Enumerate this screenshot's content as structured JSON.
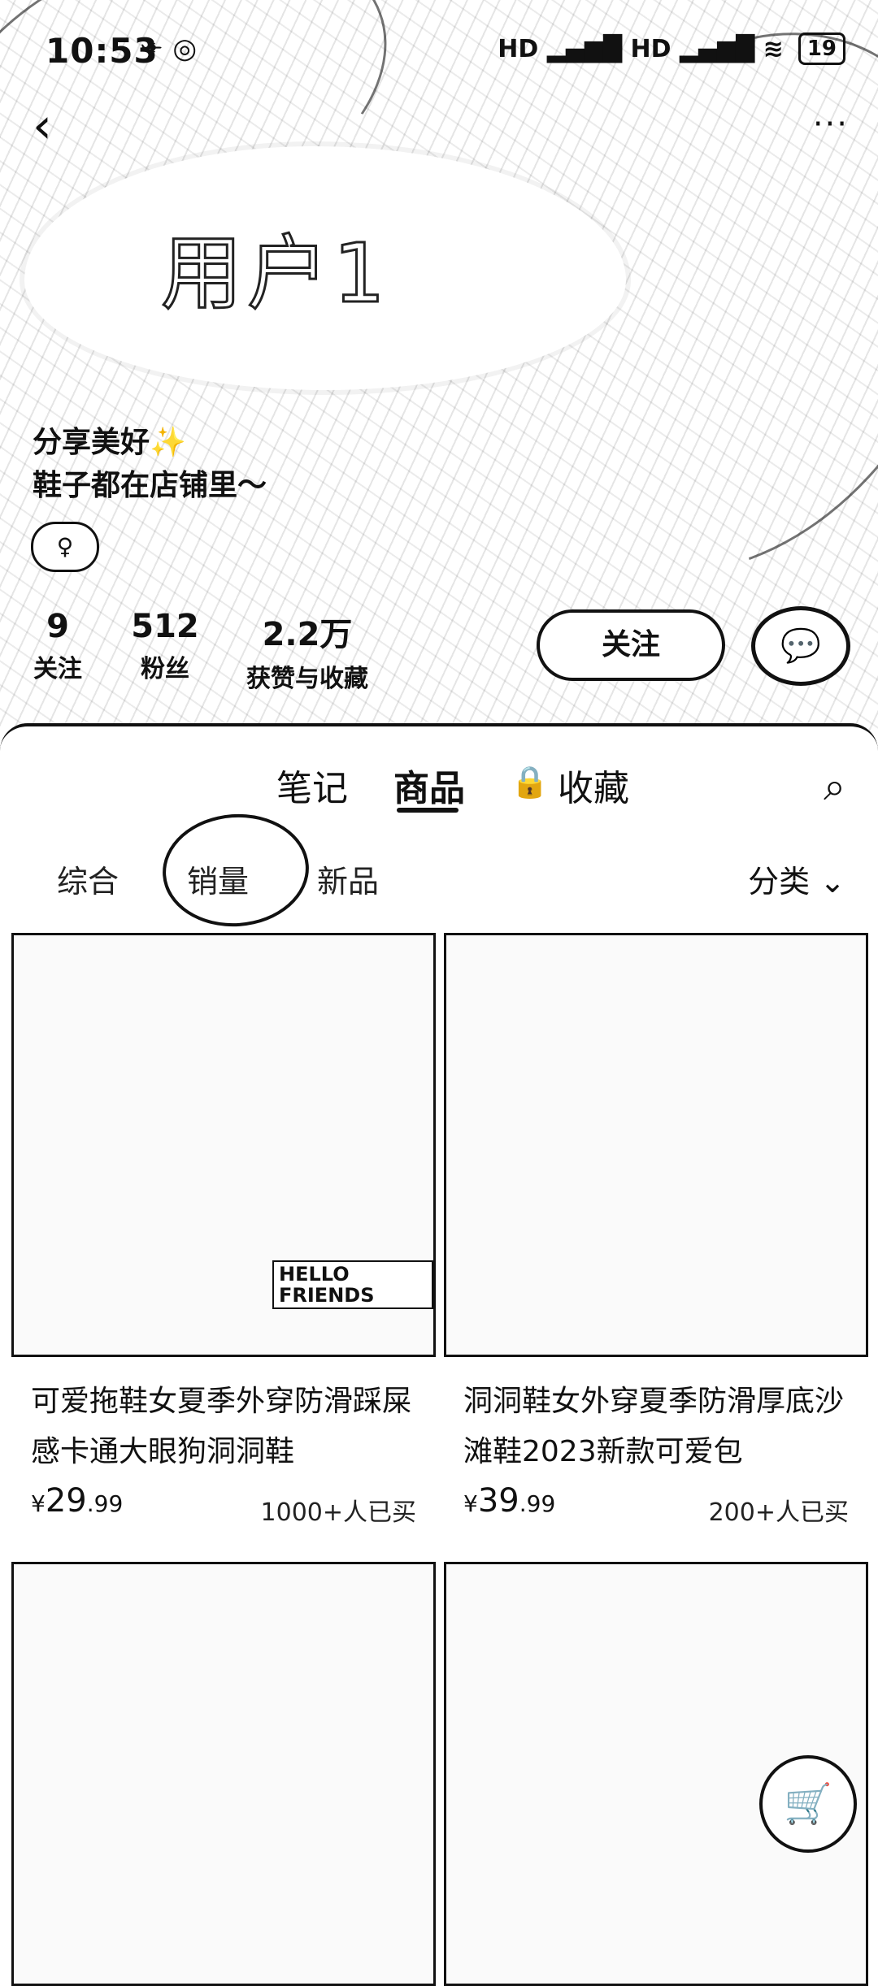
{
  "status_bar": {
    "time": "10:53",
    "icons_left": "✈ ◎",
    "network": "HD ▂▄▆█ HD ▂▄▆█ ≋",
    "battery": "19"
  },
  "header": {
    "back_icon": "‹",
    "more_icon": "···",
    "username": "用户1",
    "bio_line1": "分享美好✨",
    "bio_line2": "鞋子都在店铺里～",
    "gender_icon": "♀"
  },
  "stats": [
    {
      "value": "9",
      "label": "关注"
    },
    {
      "value": "512",
      "label": "粉丝"
    },
    {
      "value": "2.2万",
      "label": "获赞与收藏"
    }
  ],
  "actions": {
    "follow_label": "关注",
    "chat_icon": "💬"
  },
  "tabs": {
    "notes": "笔记",
    "products": "商品",
    "lock_icon": "🔒",
    "favorites": "收藏",
    "search_icon": "⌕"
  },
  "subtabs": {
    "overall": "综合",
    "sales": "销量",
    "new": "新品",
    "category": "分类 ⌄"
  },
  "products": [
    {
      "title": "可爱拖鞋女夏季外穿防滑踩屎感卡通大眼狗洞洞鞋",
      "currency": "¥",
      "price_int": "29",
      "price_dec": ".99",
      "sold": "1000+人已买",
      "badge": "HELLO FRIENDS"
    },
    {
      "title": "洞洞鞋女外穿夏季防滑厚底沙滩鞋2023新款可爱包",
      "currency": "¥",
      "price_int": "39",
      "price_dec": ".99",
      "sold": "200+人已买"
    },
    {
      "title": ""
    },
    {
      "title": ""
    }
  ],
  "cart_icon": "🛒"
}
